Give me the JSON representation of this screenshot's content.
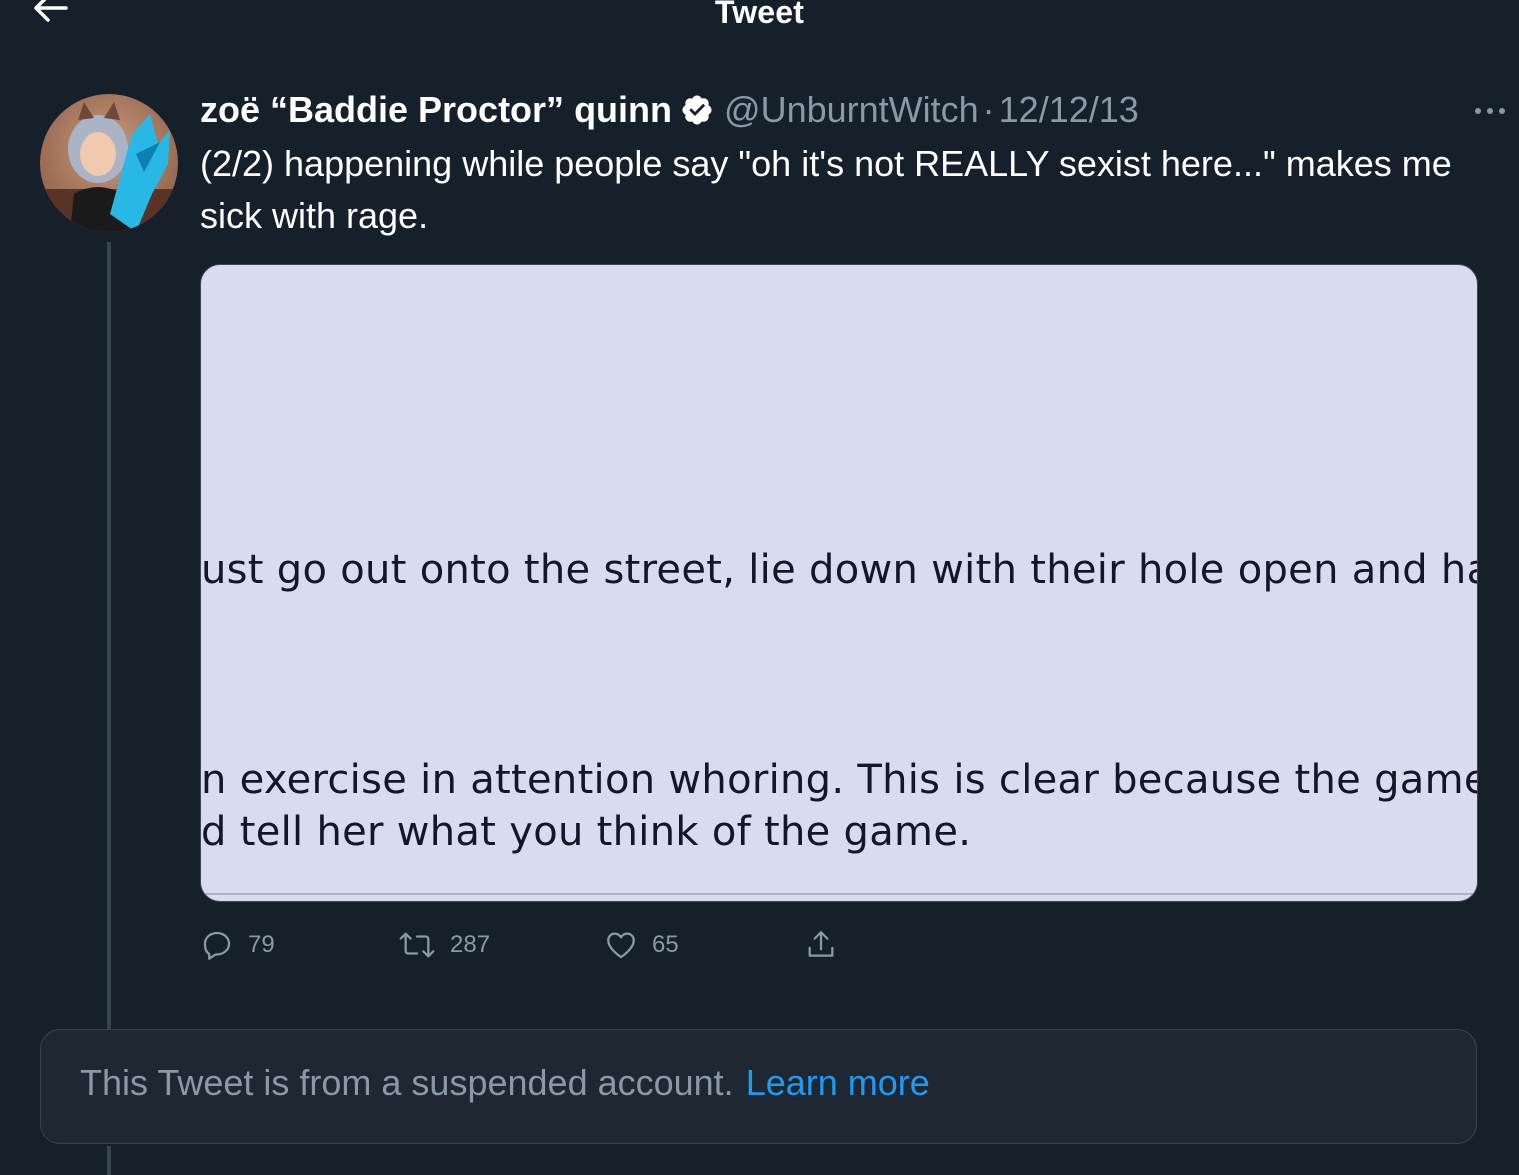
{
  "header": {
    "title": "Tweet",
    "back_icon": "arrow-left-icon"
  },
  "tweet": {
    "author": {
      "display_name": "zoë “Baddie Proctor” quinn",
      "handle": "@UnburntWitch",
      "verified": true
    },
    "separator": "·",
    "date": "12/12/13",
    "text": "(2/2) happening while people say \"oh it's not REALLY sexist here...\" makes me sick with rage.",
    "media": {
      "lines": [
        "ust go out onto the street, lie down with their hole open and have any",
        "n exercise in attention whoring. This is clear because the game is al",
        "d tell her what you think of the game."
      ]
    },
    "actions": {
      "replies": "79",
      "retweets": "287",
      "likes": "65"
    }
  },
  "suspended_notice": {
    "text": "This Tweet is from a suspended account.",
    "link_label": "Learn more"
  },
  "colors": {
    "background": "#15202b",
    "secondary_text": "#8b98a5",
    "link": "#1d9bf0",
    "border": "#38444d",
    "media_background": "#d9dbef"
  }
}
